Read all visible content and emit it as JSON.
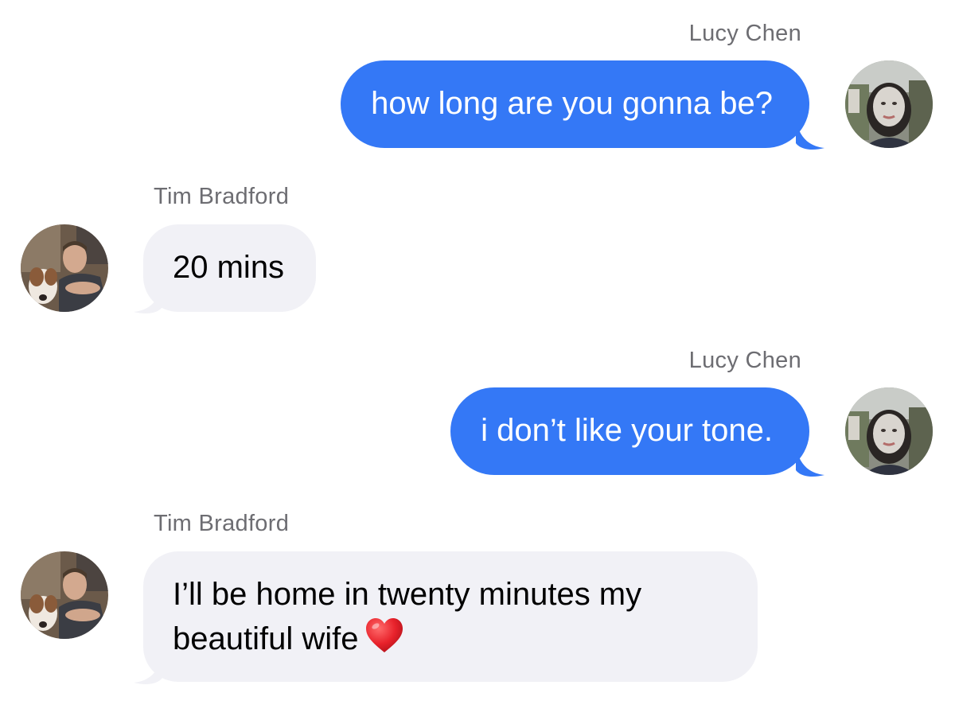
{
  "conversation": {
    "messages": [
      {
        "sender": "Lucy Chen",
        "direction": "outgoing",
        "text": "how long are you gonna be?"
      },
      {
        "sender": "Tim Bradford",
        "direction": "incoming",
        "text": "20 mins"
      },
      {
        "sender": "Lucy Chen",
        "direction": "outgoing",
        "text": "i don’t like your tone."
      },
      {
        "sender": "Tim Bradford",
        "direction": "incoming",
        "text_line1": "I’ll be home in twenty minutes my",
        "text_line2": "beautiful wife",
        "emoji": "red-heart-icon"
      }
    ]
  },
  "colors": {
    "outgoing_bubble": "#3478f6",
    "incoming_bubble": "#f1f1f6",
    "sender_label": "#6d6d72"
  }
}
